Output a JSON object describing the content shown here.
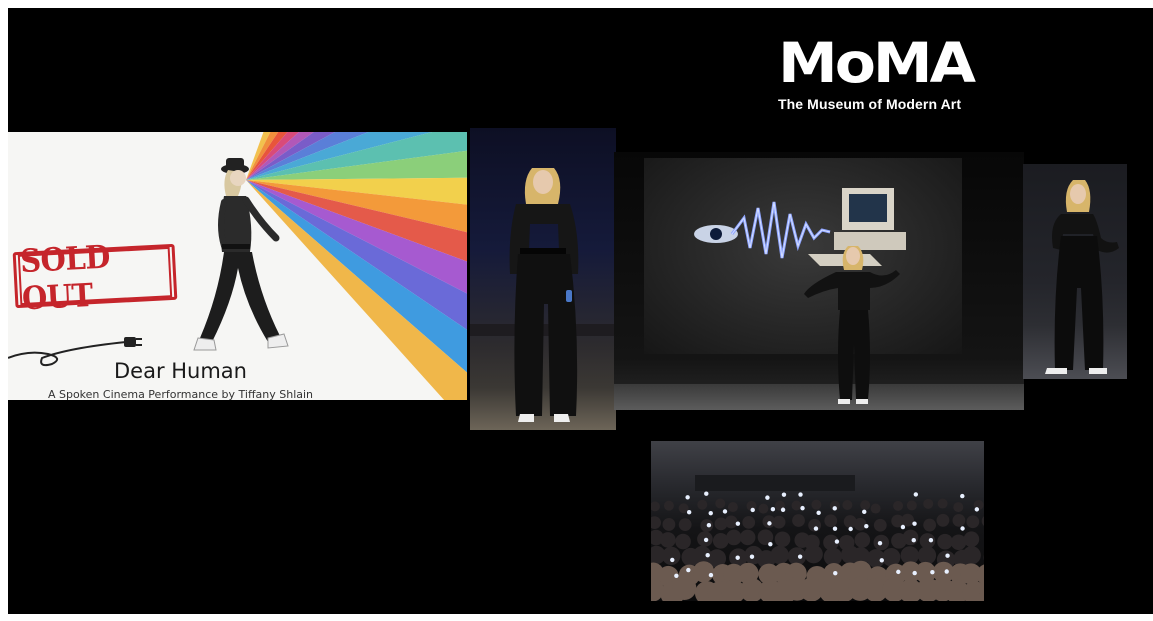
{
  "logo": {
    "wordmark": "MoMA",
    "tagline": "The Museum of Modern Art"
  },
  "poster": {
    "stamp_text": "SOLD OUT",
    "title": "Dear Human",
    "subtitle": "A Spoken Cinema Performance by Tiffany Shlain",
    "ray_colors": [
      "#f2c14e",
      "#f08f3c",
      "#e8553b",
      "#d94a7a",
      "#b158b8",
      "#7a5cc8",
      "#5a7fd8",
      "#4aa9d6",
      "#5cc0b0",
      "#8bcf7a",
      "#f2d04c",
      "#f39a3a",
      "#e45a4a",
      "#a65ad0",
      "#6a6ad8",
      "#3f9be0",
      "#f0b74a"
    ],
    "stamp_color": "#c5252b"
  },
  "photos": [
    {
      "name": "performer-standing-photo"
    },
    {
      "name": "stage-performance-photo"
    },
    {
      "name": "performer-side-photo"
    },
    {
      "name": "audience-phone-lights-photo"
    }
  ]
}
